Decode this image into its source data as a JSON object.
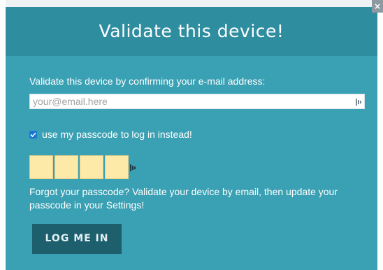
{
  "dialog": {
    "title": "Validate this device!",
    "close_label": "×",
    "prompt": "Validate this device by confirming your e-mail address:",
    "email": {
      "value": "",
      "placeholder": "your@email.here"
    },
    "passcode_option": {
      "checked": true,
      "label": "use my passcode to log in instead!"
    },
    "passcode_digits": [
      "",
      "",
      "",
      ""
    ],
    "forgot_text": "Forgot your passcode? Validate your device by email, then update your passcode in your Settings!",
    "login_button": "LOG ME IN"
  },
  "colors": {
    "modal_bg": "#3aa0b3",
    "header_bg": "#2e8d9f",
    "digit_bg": "#fde9a8",
    "button_bg": "#1e5f6e",
    "checkbox": "#1976d2"
  },
  "icons": {
    "close": "close-icon",
    "password_manager": "password-manager-icon",
    "check": "check-icon"
  }
}
